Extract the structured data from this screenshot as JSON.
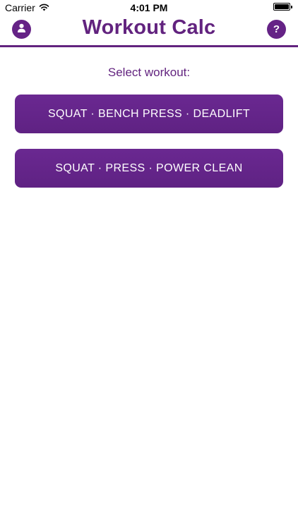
{
  "status_bar": {
    "carrier": "Carrier",
    "time": "4:01 PM",
    "icons": [
      "wifi-icon",
      "battery-icon"
    ]
  },
  "header": {
    "title": "Workout Calc",
    "left_button_icon": "user-icon",
    "right_button_icon": "question-icon",
    "right_button_glyph": "?"
  },
  "main": {
    "prompt": "Select workout:",
    "workouts": [
      {
        "label": "SQUAT · BENCH PRESS · DEADLIFT"
      },
      {
        "label": "SQUAT · PRESS · POWER CLEAN"
      }
    ]
  },
  "colors": {
    "accent": "#62237f",
    "button": "#652386",
    "background": "#ffffff"
  }
}
